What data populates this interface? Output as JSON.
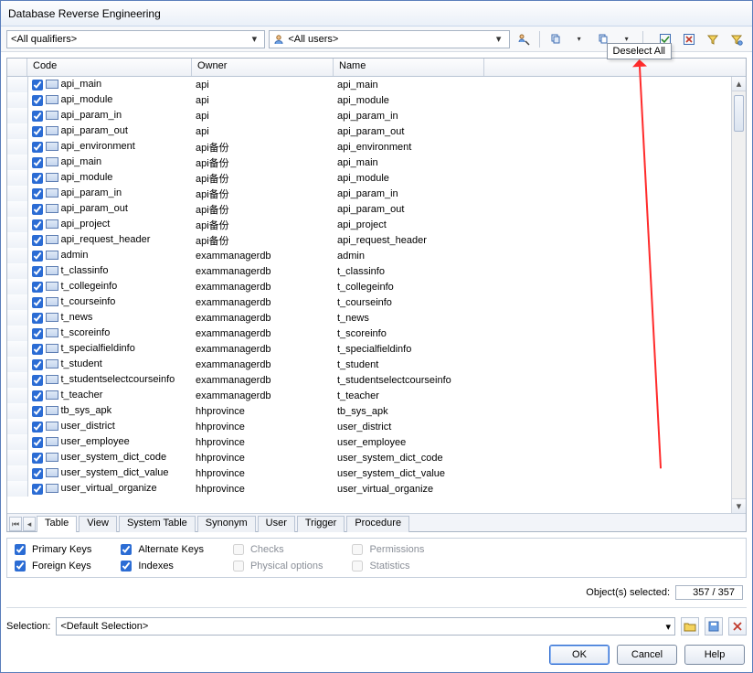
{
  "window": {
    "title": "Database Reverse Engineering"
  },
  "toolbar": {
    "qualifiers_label": "<All qualifiers>",
    "users_label": "<All users>",
    "tooltip": "Deselect All"
  },
  "columns": {
    "code": "Code",
    "owner": "Owner",
    "name": "Name"
  },
  "rows": [
    {
      "code": "api_main",
      "owner": "api",
      "name": "api_main"
    },
    {
      "code": "api_module",
      "owner": "api",
      "name": "api_module"
    },
    {
      "code": "api_param_in",
      "owner": "api",
      "name": "api_param_in"
    },
    {
      "code": "api_param_out",
      "owner": "api",
      "name": "api_param_out"
    },
    {
      "code": "api_environment",
      "owner": "api备份",
      "name": "api_environment"
    },
    {
      "code": "api_main",
      "owner": "api备份",
      "name": "api_main"
    },
    {
      "code": "api_module",
      "owner": "api备份",
      "name": "api_module"
    },
    {
      "code": "api_param_in",
      "owner": "api备份",
      "name": "api_param_in"
    },
    {
      "code": "api_param_out",
      "owner": "api备份",
      "name": "api_param_out"
    },
    {
      "code": "api_project",
      "owner": "api备份",
      "name": "api_project"
    },
    {
      "code": "api_request_header",
      "owner": "api备份",
      "name": "api_request_header"
    },
    {
      "code": "admin",
      "owner": "exammanagerdb",
      "name": "admin"
    },
    {
      "code": "t_classinfo",
      "owner": "exammanagerdb",
      "name": "t_classinfo"
    },
    {
      "code": "t_collegeinfo",
      "owner": "exammanagerdb",
      "name": "t_collegeinfo"
    },
    {
      "code": "t_courseinfo",
      "owner": "exammanagerdb",
      "name": "t_courseinfo"
    },
    {
      "code": "t_news",
      "owner": "exammanagerdb",
      "name": "t_news"
    },
    {
      "code": "t_scoreinfo",
      "owner": "exammanagerdb",
      "name": "t_scoreinfo"
    },
    {
      "code": "t_specialfieldinfo",
      "owner": "exammanagerdb",
      "name": "t_specialfieldinfo"
    },
    {
      "code": "t_student",
      "owner": "exammanagerdb",
      "name": "t_student"
    },
    {
      "code": "t_studentselectcourseinfo",
      "owner": "exammanagerdb",
      "name": "t_studentselectcourseinfo"
    },
    {
      "code": "t_teacher",
      "owner": "exammanagerdb",
      "name": "t_teacher"
    },
    {
      "code": "tb_sys_apk",
      "owner": "hhprovince",
      "name": "tb_sys_apk"
    },
    {
      "code": "user_district",
      "owner": "hhprovince",
      "name": "user_district"
    },
    {
      "code": "user_employee",
      "owner": "hhprovince",
      "name": "user_employee"
    },
    {
      "code": "user_system_dict_code",
      "owner": "hhprovince",
      "name": "user_system_dict_code"
    },
    {
      "code": "user_system_dict_value",
      "owner": "hhprovince",
      "name": "user_system_dict_value"
    },
    {
      "code": "user_virtual_organize",
      "owner": "hhprovince",
      "name": "user_virtual_organize"
    }
  ],
  "tabs": {
    "items": [
      "Table",
      "View",
      "System Table",
      "Synonym",
      "User",
      "Trigger",
      "Procedure"
    ],
    "active_index": 0
  },
  "options": {
    "primary_keys": {
      "label": "Primary Keys",
      "checked": true,
      "enabled": true
    },
    "foreign_keys": {
      "label": "Foreign Keys",
      "checked": true,
      "enabled": true
    },
    "alternate_keys": {
      "label": "Alternate Keys",
      "checked": true,
      "enabled": true
    },
    "indexes": {
      "label": "Indexes",
      "checked": true,
      "enabled": true
    },
    "checks": {
      "label": "Checks",
      "checked": false,
      "enabled": false
    },
    "physical": {
      "label": "Physical options",
      "checked": false,
      "enabled": false
    },
    "permissions": {
      "label": "Permissions",
      "checked": false,
      "enabled": false
    },
    "statistics": {
      "label": "Statistics",
      "checked": false,
      "enabled": false
    }
  },
  "status": {
    "label": "Object(s) selected:",
    "value": "357 / 357"
  },
  "selection": {
    "label": "Selection:",
    "value": "<Default Selection>"
  },
  "buttons": {
    "ok": "OK",
    "cancel": "Cancel",
    "help": "Help"
  }
}
